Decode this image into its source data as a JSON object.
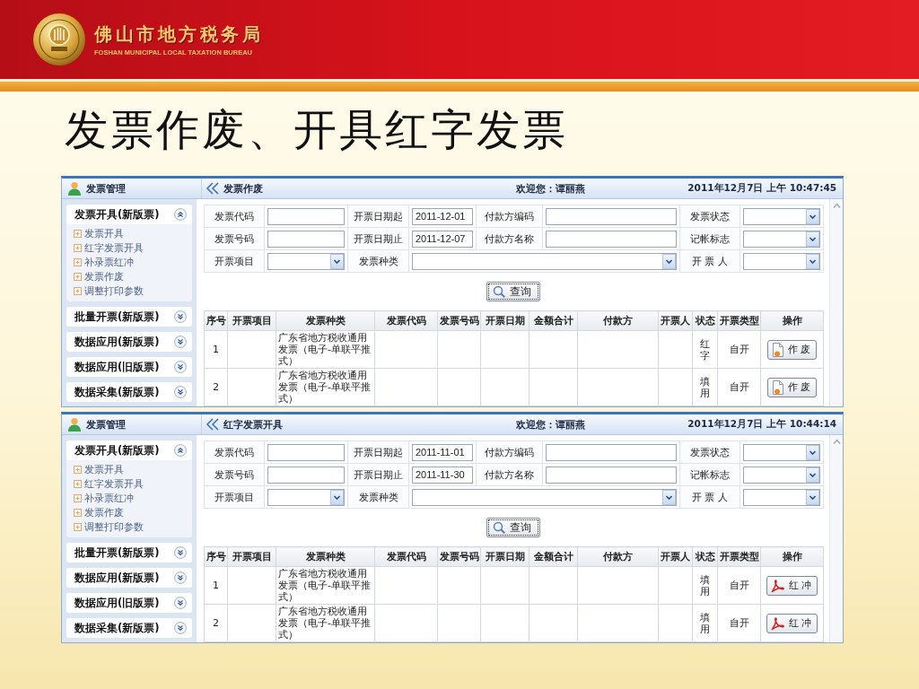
{
  "header": {
    "title": "佛山市地方税务局",
    "subtitle": "FOSHAN MUNICIPAL LOCAL TAXATION BUREAU"
  },
  "slide_title": "发票作废、开具红字发票",
  "panels": [
    {
      "sidebar": {
        "title": "发票管理",
        "sections": [
          {
            "label": "发票开具(新版票)",
            "expanded": true,
            "items": [
              "发票开具",
              "红字发票开具",
              "补录票红冲",
              "发票作废",
              "调整打印参数"
            ]
          },
          {
            "label": "批量开票(新版票)",
            "expanded": false
          },
          {
            "label": "数据应用(新版票)",
            "expanded": false
          },
          {
            "label": "数据应用(旧版票)",
            "expanded": false
          },
          {
            "label": "数据采集(新版票)",
            "expanded": false
          }
        ]
      },
      "page_title": "发票作废",
      "welcome": "欢迎您：谭丽燕",
      "datetime": "2011年12月7日 上午 10:47:45",
      "form": {
        "rows": [
          [
            {
              "label": "发票代码",
              "kind": "text"
            },
            {
              "label": "开票日期起",
              "kind": "text",
              "value": "2011-12-01"
            },
            {
              "label": "付款方编码",
              "kind": "text"
            },
            {
              "label": "发票状态",
              "kind": "select"
            }
          ],
          [
            {
              "label": "发票号码",
              "kind": "text"
            },
            {
              "label": "开票日期止",
              "kind": "text",
              "value": "2011-12-07"
            },
            {
              "label": "付款方名称",
              "kind": "text"
            },
            {
              "label": "记帐标志",
              "kind": "select"
            }
          ],
          [
            {
              "label": "开票项目",
              "kind": "select"
            },
            {
              "label": "发票种类",
              "kind": "select"
            },
            "",
            {
              "label": "开 票 人",
              "kind": "select"
            }
          ]
        ]
      },
      "query_button": "查询",
      "table": {
        "columns": [
          "序号",
          "开票项目",
          "发票种类",
          "发票代码",
          "发票号码",
          "开票日期",
          "金额合计",
          "付款方",
          "开票人",
          "状态",
          "开票类型",
          "操作"
        ],
        "rows": [
          {
            "number": "1",
            "invoice_type": "广东省地方税收通用发票（电子-单联平推式）",
            "status": "红字",
            "issue_type": "自开",
            "action": {
              "kind": "void",
              "label": "作 废"
            }
          },
          {
            "number": "2",
            "invoice_type": "广东省地方税收通用发票（电子-单联平推式）",
            "status": "填用",
            "issue_type": "自开",
            "action": {
              "kind": "void",
              "label": "作 废"
            }
          }
        ]
      }
    },
    {
      "sidebar": {
        "title": "发票管理",
        "sections": [
          {
            "label": "发票开具(新版票)",
            "expanded": true,
            "items": [
              "发票开具",
              "红字发票开具",
              "补录票红冲",
              "发票作废",
              "调整打印参数"
            ]
          },
          {
            "label": "批量开票(新版票)",
            "expanded": false
          },
          {
            "label": "数据应用(新版票)",
            "expanded": false
          },
          {
            "label": "数据应用(旧版票)",
            "expanded": false
          },
          {
            "label": "数据采集(新版票)",
            "expanded": false
          }
        ]
      },
      "page_title": "红字发票开具",
      "welcome": "欢迎您：谭丽燕",
      "datetime": "2011年12月7日 上午 10:44:14",
      "form": {
        "rows": [
          [
            {
              "label": "发票代码",
              "kind": "text"
            },
            {
              "label": "开票日期起",
              "kind": "text",
              "value": "2011-11-01"
            },
            {
              "label": "付款方编码",
              "kind": "text"
            },
            {
              "label": "发票状态",
              "kind": "select"
            }
          ],
          [
            {
              "label": "发票号码",
              "kind": "text"
            },
            {
              "label": "开票日期止",
              "kind": "text",
              "value": "2011-11-30"
            },
            {
              "label": "付款方名称",
              "kind": "text"
            },
            {
              "label": "记帐标志",
              "kind": "select"
            }
          ],
          [
            {
              "label": "开票项目",
              "kind": "select"
            },
            {
              "label": "发票种类",
              "kind": "select"
            },
            "",
            {
              "label": "开 票 人",
              "kind": "select"
            }
          ]
        ]
      },
      "query_button": "查询",
      "table": {
        "columns": [
          "序号",
          "开票项目",
          "发票种类",
          "发票代码",
          "发票号码",
          "开票日期",
          "金额合计",
          "付款方",
          "开票人",
          "状态",
          "开票类型",
          "操作"
        ],
        "rows": [
          {
            "number": "1",
            "invoice_type": "广东省地方税收通用发票（电子-单联平推式）",
            "status": "填用",
            "issue_type": "自开",
            "action": {
              "kind": "reverse",
              "label": "红 冲"
            }
          },
          {
            "number": "2",
            "invoice_type": "广东省地方税收通用发票（电子-单联平推式）",
            "status": "填用",
            "issue_type": "自开",
            "action": {
              "kind": "reverse",
              "label": "红 冲"
            }
          }
        ]
      }
    }
  ]
}
